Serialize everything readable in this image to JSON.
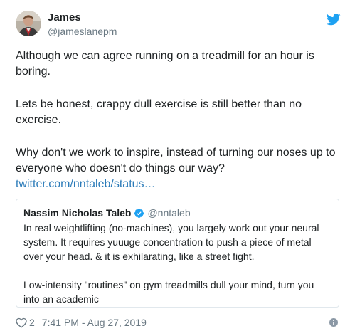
{
  "author": {
    "name": "James",
    "handle": "@jameslanepm"
  },
  "tweet": {
    "paragraphs": [
      "Although we can agree running on a treadmill for an hour is boring.",
      "Lets be honest, crappy dull exercise is still better than no exercise.",
      "Why don't we work to inspire, instead of turning our noses up to everyone who doesn't do things our way?"
    ],
    "link": "twitter.com/nntaleb/status…"
  },
  "quoted_tweet": {
    "name": "Nassim Nicholas Taleb",
    "handle": "@nntaleb",
    "paragraphs": [
      "In real weightlifting (no-machines), you largely work out your neural system. It requires yuuuge concentration to push a piece of metal over your head. & it is exhilarating, like a street fight.",
      "Low-intensity \"routines\" on gym treadmills dull your mind, turn you into an academic"
    ]
  },
  "footer": {
    "likes": "2",
    "timestamp": "7:41 PM - Aug 27, 2019"
  },
  "icons": {
    "brand": "twitter-bird-icon",
    "verified": "verified-badge-icon",
    "like": "heart-icon",
    "info": "info-icon"
  },
  "colors": {
    "twitter_blue": "#1da1f2",
    "link": "#2b7bb9",
    "secondary_text": "#697882",
    "border": "#e1e8ed"
  }
}
